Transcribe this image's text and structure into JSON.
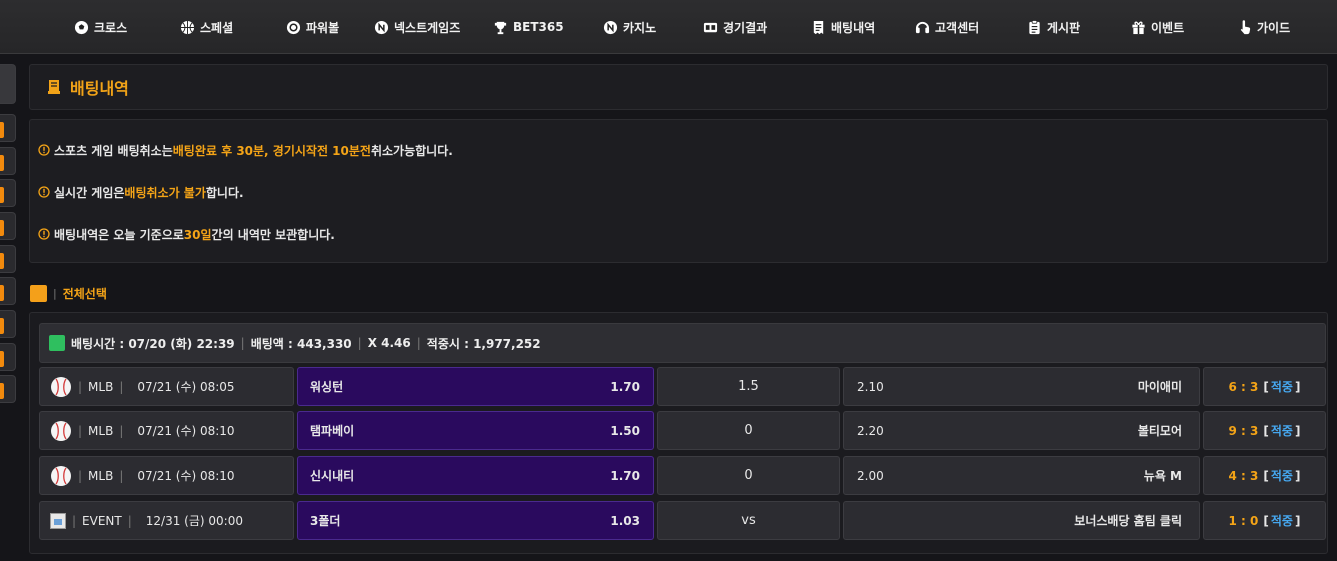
{
  "nav": {
    "items": [
      {
        "label": "크로스",
        "icon": "soccer-ball-icon"
      },
      {
        "label": "스페셜",
        "icon": "basketball-icon"
      },
      {
        "label": "파워볼",
        "icon": "powerball-icon"
      },
      {
        "label": "넥스트게임즈",
        "icon": "n-circle-icon"
      },
      {
        "label": "BET365",
        "icon": "trophy-icon"
      },
      {
        "label": "카지노",
        "icon": "n-circle-icon"
      },
      {
        "label": "경기결과",
        "icon": "scoreboard-icon"
      },
      {
        "label": "배팅내역",
        "icon": "receipt-icon"
      },
      {
        "label": "고객센터",
        "icon": "headset-icon"
      },
      {
        "label": "게시판",
        "icon": "clipboard-icon"
      },
      {
        "label": "이벤트",
        "icon": "gift-icon"
      },
      {
        "label": "가이드",
        "icon": "hand-pointer-icon"
      }
    ]
  },
  "page": {
    "title": "배팅내역"
  },
  "notices": [
    {
      "parts": [
        "스포츠 게임 배팅취소는 ",
        "배팅완료 후 30분, 경기시작전 10분전",
        " 취소가능합니다."
      ]
    },
    {
      "parts": [
        "실시간 게임은 ",
        "배팅취소가 불가",
        "합니다."
      ]
    },
    {
      "parts": [
        "배팅내역은 오늘 기준으로 ",
        "30일",
        "간의 내역만 보관합니다."
      ]
    }
  ],
  "select_all": {
    "label": "전체선택"
  },
  "bet": {
    "time_label": "배팅시간 : 07/20 (화) 22:39",
    "amount_label": "배팅액 : 443,330",
    "odds_label": "X 4.46",
    "win_label": "적중시 : 1,977,252",
    "rows": [
      {
        "league": "MLB",
        "time": "07/21 (수) 08:05",
        "home": "워싱턴",
        "home_odds": "1.70",
        "mid": "1.5",
        "away_odds": "2.10",
        "away": "마이애미",
        "score": "6 : 3",
        "result": "적중",
        "icon": "baseball-icon"
      },
      {
        "league": "MLB",
        "time": "07/21 (수) 08:10",
        "home": "탬파베이",
        "home_odds": "1.50",
        "mid": "0",
        "away_odds": "2.20",
        "away": "볼티모어",
        "score": "9 : 3",
        "result": "적중",
        "icon": "baseball-icon"
      },
      {
        "league": "MLB",
        "time": "07/21 (수) 08:10",
        "home": "신시내티",
        "home_odds": "1.70",
        "mid": "0",
        "away_odds": "2.00",
        "away": "뉴욕 M",
        "score": "4 : 3",
        "result": "적중",
        "icon": "baseball-icon"
      },
      {
        "league": "EVENT",
        "time": "12/31 (금) 00:00",
        "home": "3폴더",
        "home_odds": "1.03",
        "mid": "vs",
        "away_odds": "",
        "away": "보너스배당 홈팀 클릭",
        "score": "1 : 0",
        "result": "적중",
        "icon": "broken-image-icon"
      }
    ]
  },
  "colors": {
    "accent": "#f4a417",
    "home_cell": "#2a0a5e",
    "hit_link": "#46a8f0",
    "check_green": "#2fbf5f"
  }
}
